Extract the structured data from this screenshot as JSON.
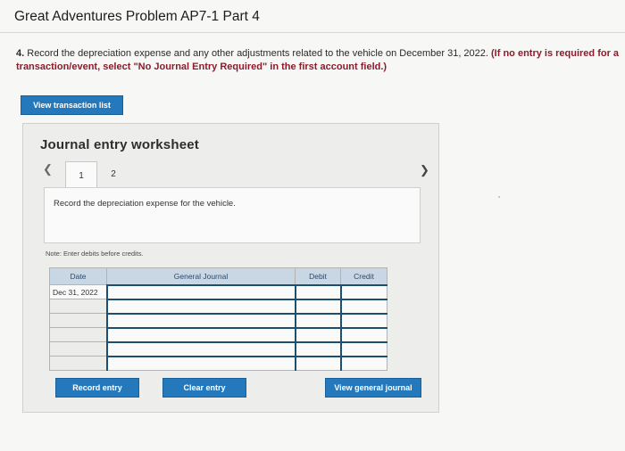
{
  "header": {
    "title": "Great Adventures Problem AP7-1 Part 4"
  },
  "question": {
    "number": "4.",
    "text": " Record the depreciation expense and any other adjustments related to the vehicle on December 31, 2022. ",
    "instruction": "(If no entry is required for a transaction/event, select \"No Journal Entry Required\" in the first account field.)"
  },
  "buttons": {
    "view_transaction_list": "View transaction list",
    "record_entry": "Record entry",
    "clear_entry": "Clear entry",
    "view_general_journal": "View general journal"
  },
  "worksheet": {
    "title": "Journal entry worksheet",
    "prev_icon": "chevron-left-icon",
    "next_icon": "chevron-right-icon",
    "tabs": [
      "1",
      "2"
    ],
    "active_tab": "1",
    "description": "Record the depreciation expense for the vehicle.",
    "note": "Note: Enter debits before credits."
  },
  "journal": {
    "headers": {
      "date": "Date",
      "general_journal": "General Journal",
      "debit": "Debit",
      "credit": "Credit"
    },
    "rows": [
      {
        "date": "Dec 31, 2022",
        "account": "",
        "debit": "",
        "credit": ""
      },
      {
        "date": "",
        "account": "",
        "debit": "",
        "credit": ""
      },
      {
        "date": "",
        "account": "",
        "debit": "",
        "credit": ""
      },
      {
        "date": "",
        "account": "",
        "debit": "",
        "credit": ""
      },
      {
        "date": "",
        "account": "",
        "debit": "",
        "credit": ""
      },
      {
        "date": "",
        "account": "",
        "debit": "",
        "credit": ""
      }
    ]
  },
  "colors": {
    "button_blue": "#2479bd",
    "header_blue": "#c9d6e3",
    "instruction_red": "#8a1c2c"
  }
}
